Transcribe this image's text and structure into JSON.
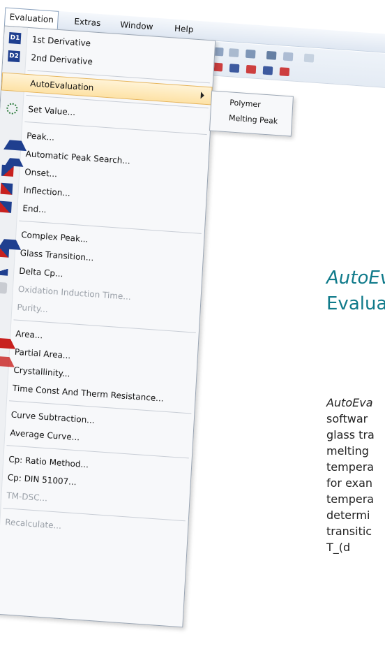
{
  "menubar": {
    "items": [
      "Evaluation",
      "Extras",
      "Window",
      "Help"
    ]
  },
  "menu": {
    "top": [
      "1st Derivative",
      "2nd Derivative"
    ],
    "autoeval": "AutoEvaluation",
    "setvalue": "Set Value...",
    "group1": [
      "Peak...",
      "Automatic Peak Search...",
      "Onset...",
      "Inflection...",
      "End..."
    ],
    "group2": [
      "Complex Peak...",
      "Glass Transition...",
      "Delta Cp...",
      "Oxidation Induction Time...",
      "Purity..."
    ],
    "group3": [
      "Area...",
      "Partial Area...",
      "Crystallinity...",
      "Time Const And Therm Resistance..."
    ],
    "group4": [
      "Curve Subtraction...",
      "Average Curve..."
    ],
    "group5": [
      "Cp: Ratio Method...",
      "Cp: DIN 51007...",
      "TM-DSC..."
    ],
    "recalc": "Recalculate..."
  },
  "submenu": {
    "items": [
      "Polymer",
      "Melting Peak"
    ]
  },
  "side": {
    "heading1": "AutoEv",
    "heading2": "Evalua",
    "para": [
      "AutoEva",
      "softwar",
      "glass tra",
      "melting",
      "tempera",
      "for exan",
      "tempera",
      "determi",
      "transitic",
      "T_(d"
    ]
  },
  "colors": {
    "highlight": "#fde2a6",
    "accent": "#0f7a8a",
    "blue": "#1f3f8f",
    "red": "#c8201e"
  }
}
